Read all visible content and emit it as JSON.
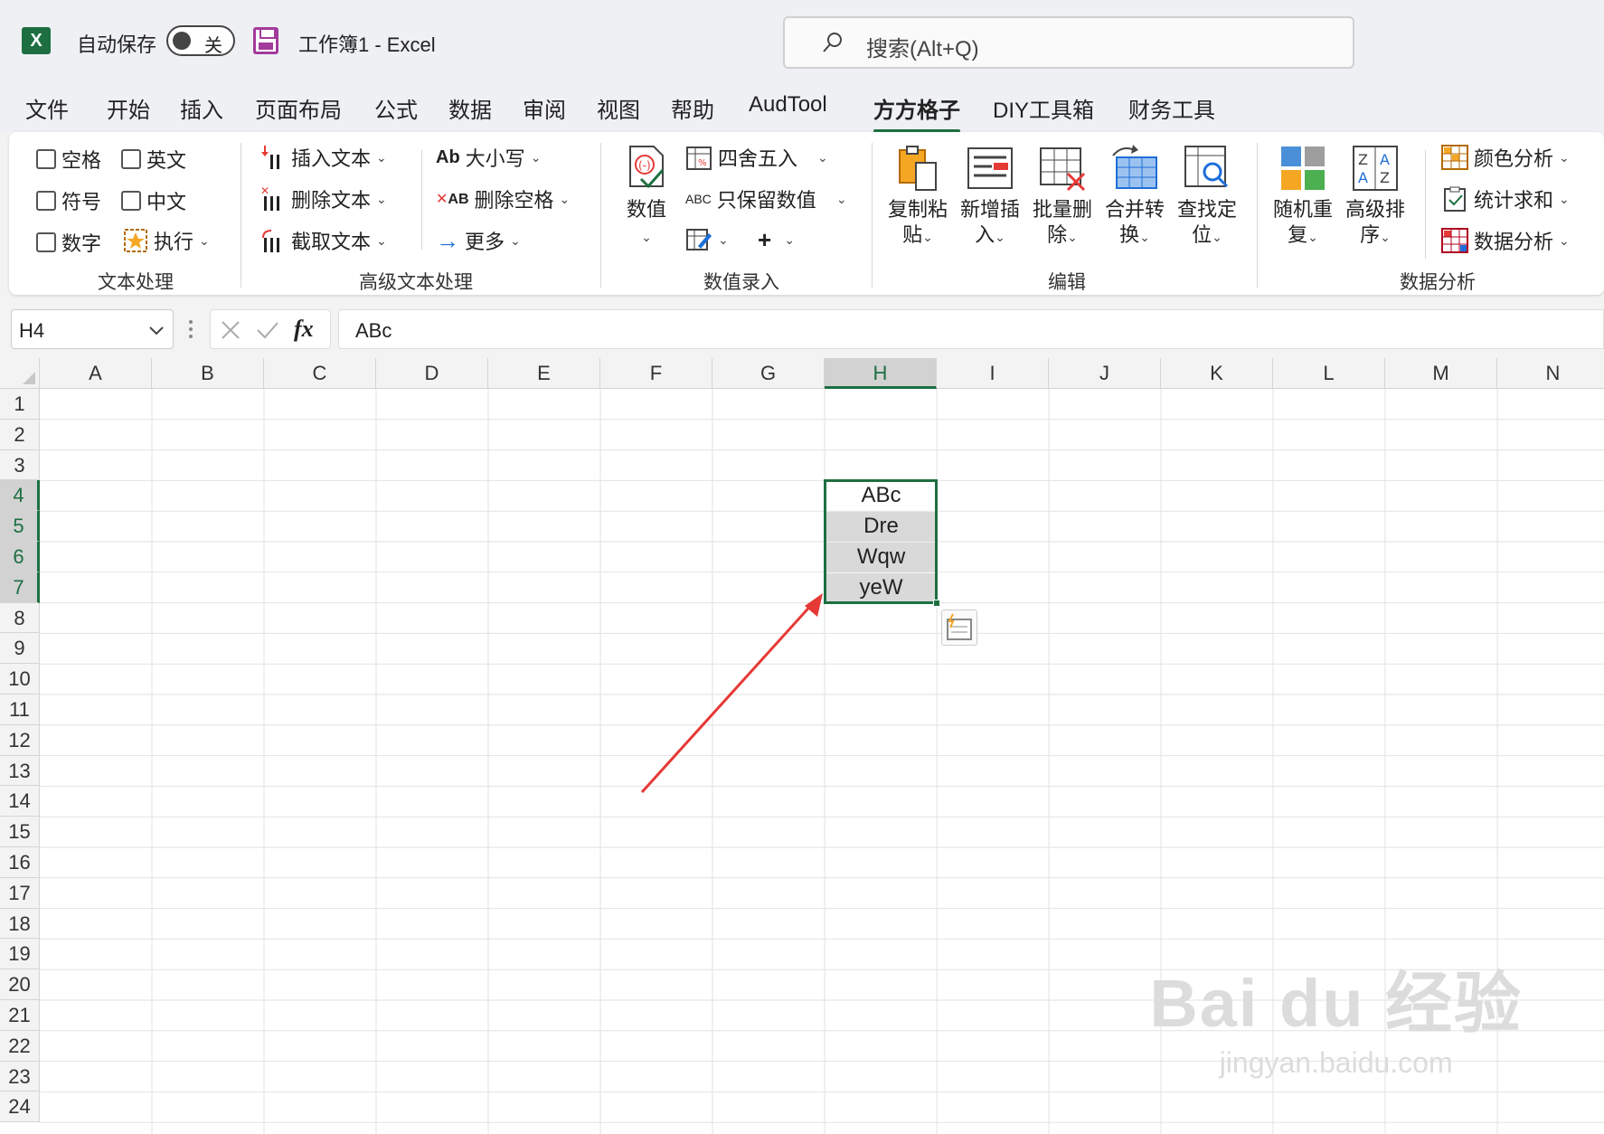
{
  "titlebar": {
    "logo": "X",
    "autosave_label": "自动保存",
    "autosave_state": "关",
    "doc_title": "工作簿1  -  Excel",
    "search_placeholder": "搜索(Alt+Q)"
  },
  "menu": [
    {
      "label": "文件",
      "active": false
    },
    {
      "label": "开始",
      "active": false
    },
    {
      "label": "插入",
      "active": false
    },
    {
      "label": "页面布局",
      "active": false
    },
    {
      "label": "公式",
      "active": false
    },
    {
      "label": "数据",
      "active": false
    },
    {
      "label": "审阅",
      "active": false
    },
    {
      "label": "视图",
      "active": false
    },
    {
      "label": "帮助",
      "active": false
    },
    {
      "label": "AudTool",
      "active": false
    },
    {
      "label": "方方格子",
      "active": true
    },
    {
      "label": "DIY工具箱",
      "active": false
    },
    {
      "label": "财务工具",
      "active": false
    }
  ],
  "ribbon": {
    "text_processing": {
      "label": "文本处理",
      "kongge": "空格",
      "yingwen": "英文",
      "fuhao": "符号",
      "zhongwen": "中文",
      "shuzi": "数字",
      "zhixing": "执行"
    },
    "advanced_text": {
      "label": "高级文本处理",
      "insert_text": "插入文本",
      "delete_text": "删除文本",
      "extract_text": "截取文本",
      "case_icon": "Ab",
      "case": "大小写",
      "del_space_icon": "AB",
      "del_space": "删除空格",
      "more": "更多"
    },
    "numeric_entry": {
      "label": "数值录入",
      "value": "数值",
      "round": "四舍五入",
      "keep_icon": "ABC",
      "keep_values": "只保留数值",
      "plus": "+"
    },
    "edit": {
      "label": "编辑",
      "copy_paste": "复制粘\n贴",
      "insert_new": "新增插\n入",
      "batch_delete": "批量删\n除",
      "merge_convert": "合并转\n换",
      "find_locate": "查找定\n位"
    },
    "data_analysis": {
      "label": "数据分析",
      "random_repeat": "随机重\n复",
      "advanced_sort": "高级排\n序",
      "color_analysis": "颜色分析",
      "stats_sum": "统计求和",
      "data_analysis": "数据分析"
    }
  },
  "formula_bar": {
    "name_box": "H4",
    "fx": "fx",
    "formula": "ABc"
  },
  "sheet": {
    "columns": [
      "A",
      "B",
      "C",
      "D",
      "E",
      "F",
      "G",
      "H",
      "I",
      "J",
      "K",
      "L",
      "M",
      "N"
    ],
    "selected_column": "H",
    "rows": [
      "1",
      "2",
      "3",
      "4",
      "5",
      "6",
      "7",
      "8",
      "9",
      "10",
      "11",
      "12",
      "13",
      "14",
      "15",
      "16",
      "17",
      "18",
      "19",
      "20",
      "21",
      "22",
      "23",
      "24"
    ],
    "selected_rows": [
      "4",
      "5",
      "6",
      "7"
    ],
    "cells": [
      {
        "ref": "H4",
        "value": "ABc",
        "highlight": false
      },
      {
        "ref": "H5",
        "value": "Dre",
        "highlight": true
      },
      {
        "ref": "H6",
        "value": "Wqw",
        "highlight": true
      },
      {
        "ref": "H7",
        "value": "yeW",
        "highlight": true
      }
    ]
  },
  "watermark": {
    "line1": "Bai du 经验",
    "line2": "jingyan.baidu.com"
  },
  "colors": {
    "excel_green": "#1d6f42",
    "arrow_red": "#e53935"
  }
}
